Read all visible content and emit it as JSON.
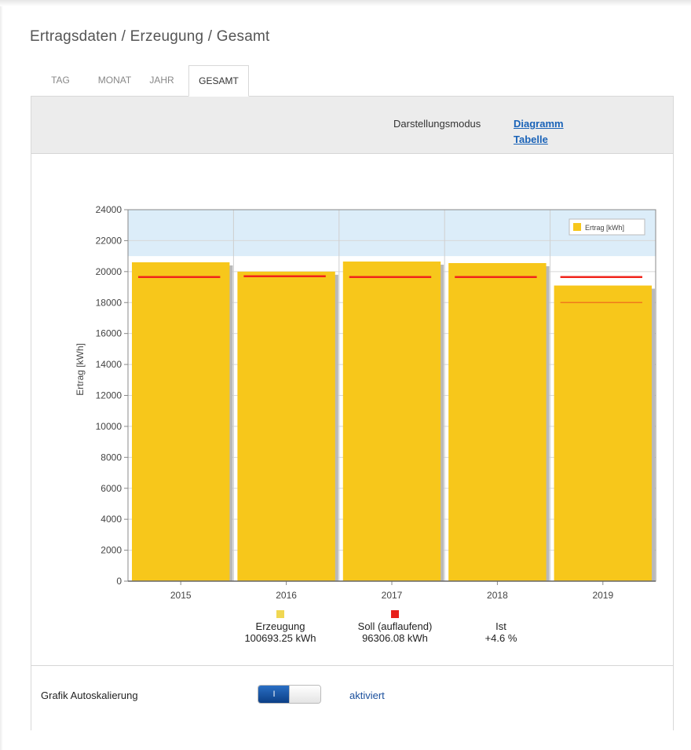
{
  "page": {
    "title": "Ertragsdaten / Erzeugung / Gesamt"
  },
  "tabs": [
    {
      "label": "TAG",
      "active": false
    },
    {
      "label": "MONAT",
      "active": false
    },
    {
      "label": "JAHR",
      "active": false
    },
    {
      "label": "GESAMT",
      "active": true
    }
  ],
  "display_mode": {
    "label": "Darstellungsmodus",
    "options": [
      "Diagramm",
      "Tabelle"
    ]
  },
  "colors": {
    "bar": "#f7c71b",
    "bar_shadow": "#b9b9b9",
    "target_line": "#f0241b",
    "target_line_partial": "#f07a1b",
    "plot_background": "#dcedf9",
    "legend_box_bar": "#f7c71b",
    "summary_generation": "#f0d752",
    "summary_target": "#e8201b",
    "toggle_on": "#1a56a8"
  },
  "chart_data": {
    "type": "bar",
    "title": "",
    "xlabel": "",
    "ylabel": "Ertrag [kWh]",
    "ylim": [
      0,
      24000
    ],
    "yticks": [
      "0",
      "2000",
      "4000",
      "6000",
      "8000",
      "10000",
      "12000",
      "14000",
      "16000",
      "18000",
      "20000",
      "22000",
      "24000"
    ],
    "categories": [
      "2015",
      "2016",
      "2017",
      "2018",
      "2019"
    ],
    "series": [
      {
        "name": "Ertrag [kWh]",
        "values": [
          20600,
          20000,
          20650,
          20550,
          19100
        ]
      }
    ],
    "target_lines": [
      19650,
      19700,
      19650,
      19650,
      19650
    ],
    "partial_target_lines": [
      null,
      null,
      null,
      null,
      18000
    ],
    "grid": true,
    "legend_position": "top-right"
  },
  "summary": {
    "generation": {
      "label": "Erzeugung",
      "value": "100693.25 kWh"
    },
    "target": {
      "label": "Soll (auflaufend)",
      "value": "96306.08 kWh"
    },
    "actual": {
      "label": "Ist",
      "value": "+4.6 %"
    }
  },
  "autoscale": {
    "label": "Grafik Autoskalierung",
    "toggle_text": "I",
    "state": "aktiviert"
  }
}
